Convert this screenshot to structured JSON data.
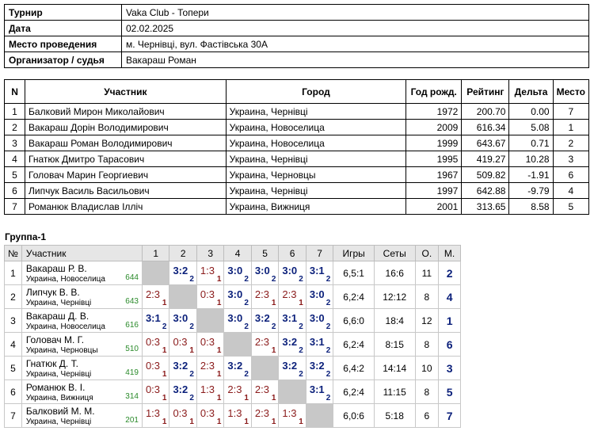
{
  "info": [
    {
      "key": "Турнир",
      "value": "Vaka Club - Топери"
    },
    {
      "key": "Дата",
      "value": "02.02.2025"
    },
    {
      "key": "Место проведения",
      "value": "м. Чернівці, вул. Фастівська 30А"
    },
    {
      "key": "Организатор / судья",
      "value": "Вакараш Роман"
    }
  ],
  "players_table": {
    "headers": {
      "n": "N",
      "name": "Участник",
      "city": "Город",
      "year": "Год рожд.",
      "rating": "Рейтинг",
      "delta": "Дельта",
      "place": "Место"
    },
    "rows": [
      {
        "n": "1",
        "name": "Балковий Мирон Миколайович",
        "city": "Украина, Чернівці",
        "year": "1972",
        "rating": "200.70",
        "delta": "0.00",
        "place": "7"
      },
      {
        "n": "2",
        "name": "Вакараш Дорін Володимирович",
        "city": "Украина, Новоселица",
        "year": "2009",
        "rating": "616.34",
        "delta": "5.08",
        "place": "1"
      },
      {
        "n": "3",
        "name": "Вакараш Роман Володимирович",
        "city": "Украина, Новоселица",
        "year": "1999",
        "rating": "643.67",
        "delta": "0.71",
        "place": "2"
      },
      {
        "n": "4",
        "name": "Гнатюк Дмитро Тарасович",
        "city": "Украина, Чернівці",
        "year": "1995",
        "rating": "419.27",
        "delta": "10.28",
        "place": "3"
      },
      {
        "n": "5",
        "name": "Головач Марин Георгиевич",
        "city": "Украина, Черновцы",
        "year": "1967",
        "rating": "509.82",
        "delta": "-1.91",
        "place": "6"
      },
      {
        "n": "6",
        "name": "Липчук Василь Васильович",
        "city": "Украина, Чернівці",
        "year": "1997",
        "rating": "642.88",
        "delta": "-9.79",
        "place": "4"
      },
      {
        "n": "7",
        "name": "Романюк Владислав Ілліч",
        "city": "Украина, Вижниця",
        "year": "2001",
        "rating": "313.65",
        "delta": "8.58",
        "place": "5"
      }
    ]
  },
  "group": {
    "title": "Группа-1",
    "headers": {
      "n": "№",
      "name": "Участник",
      "cols": [
        "1",
        "2",
        "3",
        "4",
        "5",
        "6",
        "7"
      ],
      "games": "Игры",
      "sets": "Сеты",
      "points": "О.",
      "place": "М."
    },
    "rows": [
      {
        "n": "1",
        "name": "Вакараш Р. В.",
        "city": "Украина, Новоселица",
        "rating": "644",
        "results": [
          null,
          {
            "s": "3:2",
            "p": "2"
          },
          {
            "s": "1:3",
            "p": "1"
          },
          {
            "s": "3:0",
            "p": "2"
          },
          {
            "s": "3:0",
            "p": "2"
          },
          {
            "s": "3:0",
            "p": "2"
          },
          {
            "s": "3:1",
            "p": "2"
          }
        ],
        "games": "6,5:1",
        "sets": "16:6",
        "points": "11",
        "place": "2"
      },
      {
        "n": "2",
        "name": "Липчук В. В.",
        "city": "Украина, Чернівці",
        "rating": "643",
        "results": [
          {
            "s": "2:3",
            "p": "1"
          },
          null,
          {
            "s": "0:3",
            "p": "1"
          },
          {
            "s": "3:0",
            "p": "2"
          },
          {
            "s": "2:3",
            "p": "1"
          },
          {
            "s": "2:3",
            "p": "1"
          },
          {
            "s": "3:0",
            "p": "2"
          }
        ],
        "games": "6,2:4",
        "sets": "12:12",
        "points": "8",
        "place": "4"
      },
      {
        "n": "3",
        "name": "Вакараш Д. В.",
        "city": "Украина, Новоселица",
        "rating": "616",
        "results": [
          {
            "s": "3:1",
            "p": "2"
          },
          {
            "s": "3:0",
            "p": "2"
          },
          null,
          {
            "s": "3:0",
            "p": "2"
          },
          {
            "s": "3:2",
            "p": "2"
          },
          {
            "s": "3:1",
            "p": "2"
          },
          {
            "s": "3:0",
            "p": "2"
          }
        ],
        "games": "6,6:0",
        "sets": "18:4",
        "points": "12",
        "place": "1"
      },
      {
        "n": "4",
        "name": "Головач М. Г.",
        "city": "Украина, Черновцы",
        "rating": "510",
        "results": [
          {
            "s": "0:3",
            "p": "1"
          },
          {
            "s": "0:3",
            "p": "1"
          },
          {
            "s": "0:3",
            "p": "1"
          },
          null,
          {
            "s": "2:3",
            "p": "1"
          },
          {
            "s": "3:2",
            "p": "2"
          },
          {
            "s": "3:1",
            "p": "2"
          }
        ],
        "games": "6,2:4",
        "sets": "8:15",
        "points": "8",
        "place": "6"
      },
      {
        "n": "5",
        "name": "Гнатюк Д. Т.",
        "city": "Украина, Чернівці",
        "rating": "419",
        "results": [
          {
            "s": "0:3",
            "p": "1"
          },
          {
            "s": "3:2",
            "p": "2"
          },
          {
            "s": "2:3",
            "p": "1"
          },
          {
            "s": "3:2",
            "p": "2"
          },
          null,
          {
            "s": "3:2",
            "p": "2"
          },
          {
            "s": "3:2",
            "p": "2"
          }
        ],
        "games": "6,4:2",
        "sets": "14:14",
        "points": "10",
        "place": "3"
      },
      {
        "n": "6",
        "name": "Романюк В. І.",
        "city": "Украина, Вижниця",
        "rating": "314",
        "results": [
          {
            "s": "0:3",
            "p": "1"
          },
          {
            "s": "3:2",
            "p": "2"
          },
          {
            "s": "1:3",
            "p": "1"
          },
          {
            "s": "2:3",
            "p": "1"
          },
          {
            "s": "2:3",
            "p": "1"
          },
          null,
          {
            "s": "3:1",
            "p": "2"
          }
        ],
        "games": "6,2:4",
        "sets": "11:15",
        "points": "8",
        "place": "5"
      },
      {
        "n": "7",
        "name": "Балковий М. М.",
        "city": "Украина, Чернівці",
        "rating": "201",
        "results": [
          {
            "s": "1:3",
            "p": "1"
          },
          {
            "s": "0:3",
            "p": "1"
          },
          {
            "s": "0:3",
            "p": "1"
          },
          {
            "s": "1:3",
            "p": "1"
          },
          {
            "s": "2:3",
            "p": "1"
          },
          {
            "s": "1:3",
            "p": "1"
          },
          null
        ],
        "games": "6,0:6",
        "sets": "5:18",
        "points": "6",
        "place": "7"
      }
    ]
  }
}
